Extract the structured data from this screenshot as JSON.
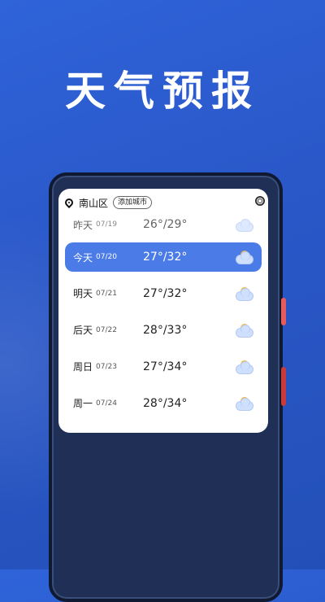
{
  "headline": "天气预报",
  "header": {
    "city": "南山区",
    "add_city_label": "添加城市"
  },
  "days": [
    {
      "day": "昨天",
      "date": "07/19",
      "temp": "26°/29°",
      "icon": "rain-cloud-icon"
    },
    {
      "day": "今天",
      "date": "07/20",
      "temp": "27°/32°",
      "icon": "partly-cloudy-icon",
      "selected": true
    },
    {
      "day": "明天",
      "date": "07/21",
      "temp": "27°/32°",
      "icon": "partly-cloudy-icon"
    },
    {
      "day": "后天",
      "date": "07/22",
      "temp": "28°/33°",
      "icon": "partly-cloudy-icon"
    },
    {
      "day": "周日",
      "date": "07/23",
      "temp": "27°/34°",
      "icon": "partly-cloudy-icon"
    },
    {
      "day": "周一",
      "date": "07/24",
      "temp": "28°/34°",
      "icon": "partly-cloudy-icon"
    }
  ],
  "colors": {
    "background": "#2a58c9",
    "selected_row": "#4a7be6"
  }
}
